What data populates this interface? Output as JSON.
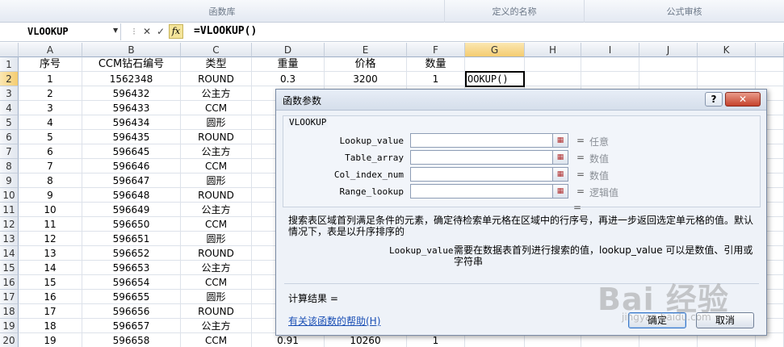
{
  "ribbon": {
    "groups": [
      "函数库",
      "定义的名称",
      "公式审核"
    ]
  },
  "formula_bar": {
    "name_box": "VLOOKUP",
    "cancel_glyph": "✕",
    "enter_glyph": "✓",
    "fx_label": "fx",
    "formula": "=VLOOKUP()"
  },
  "sheet": {
    "columns": [
      "A",
      "B",
      "C",
      "D",
      "E",
      "F",
      "G",
      "H",
      "I",
      "J",
      "K"
    ],
    "selected_column": "G",
    "row_numbers": [
      "1",
      "2",
      "3",
      "4",
      "5",
      "6",
      "7",
      "8",
      "9",
      "10",
      "11",
      "12",
      "13",
      "14",
      "15",
      "16",
      "17",
      "18",
      "19",
      "20"
    ],
    "header_row": [
      "序号",
      "CCM钻石编号",
      "类型",
      "重量",
      "价格",
      "数量"
    ],
    "rows": [
      [
        "1",
        "1562348",
        "ROUND",
        "0.3",
        "3200",
        "1"
      ],
      [
        "2",
        "596432",
        "公主方",
        "",
        "",
        ""
      ],
      [
        "3",
        "596433",
        "CCM",
        "",
        "",
        ""
      ],
      [
        "4",
        "596434",
        "圆形",
        "",
        "",
        ""
      ],
      [
        "5",
        "596435",
        "ROUND",
        "",
        "",
        ""
      ],
      [
        "6",
        "596645",
        "公主方",
        "",
        "",
        ""
      ],
      [
        "7",
        "596646",
        "CCM",
        "",
        "",
        ""
      ],
      [
        "8",
        "596647",
        "圆形",
        "",
        "",
        ""
      ],
      [
        "9",
        "596648",
        "ROUND",
        "",
        "",
        ""
      ],
      [
        "10",
        "596649",
        "公主方",
        "",
        "",
        ""
      ],
      [
        "11",
        "596650",
        "CCM",
        "",
        "",
        ""
      ],
      [
        "12",
        "596651",
        "圆形",
        "",
        "",
        ""
      ],
      [
        "13",
        "596652",
        "ROUND",
        "",
        "",
        ""
      ],
      [
        "14",
        "596653",
        "公主方",
        "",
        "",
        ""
      ],
      [
        "15",
        "596654",
        "CCM",
        "",
        "",
        ""
      ],
      [
        "16",
        "596655",
        "圆形",
        "",
        "",
        ""
      ],
      [
        "17",
        "596656",
        "ROUND",
        "",
        "",
        ""
      ],
      [
        "18",
        "596657",
        "公主方",
        "",
        "",
        ""
      ],
      [
        "19",
        "596658",
        "CCM",
        "0.91",
        "10260",
        "1"
      ]
    ],
    "active_cell_text": "OOKUP()"
  },
  "dialog": {
    "title": "函数参数",
    "help_glyph": "?",
    "close_glyph": "✕",
    "function_name": "VLOOKUP",
    "args": [
      {
        "label": "Lookup_value",
        "type": "任意"
      },
      {
        "label": "Table_array",
        "type": "数值"
      },
      {
        "label": "Col_index_num",
        "type": "数值"
      },
      {
        "label": "Range_lookup",
        "type": "逻辑值"
      }
    ],
    "equals": "=",
    "result_equals": "=",
    "description": "搜索表区域首列满足条件的元素，确定待检索单元格在区域中的行序号，再进一步返回选定单元格的值。默认情况下，表是以升序排序的",
    "arg_name": "Lookup_value",
    "arg_desc": "需要在数据表首列进行搜索的值，lookup_value 可以是数值、引用或字符串",
    "calc_result": "计算结果 =",
    "help_link": "有关该函数的帮助(H)",
    "ok_label": "确定",
    "cancel_label": "取消"
  },
  "watermark": {
    "text": "Bai 经验",
    "url": "jingyan.baidu.com"
  }
}
